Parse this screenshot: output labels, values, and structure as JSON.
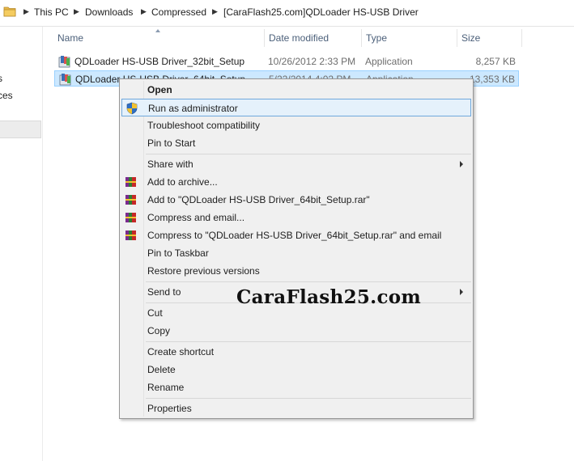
{
  "address_bar": {
    "breadcrumbs": [
      "This PC",
      "Downloads",
      "Compressed",
      "[CaraFlash25.com]QDLoader HS-USB Driver"
    ]
  },
  "nav_pane": {
    "partial_items": [
      "s",
      "ces"
    ]
  },
  "columns": {
    "name": "Name",
    "date_modified": "Date modified",
    "type": "Type",
    "size": "Size"
  },
  "files": [
    {
      "name": "QDLoader HS-USB Driver_32bit_Setup",
      "date": "10/26/2012 2:33 PM",
      "type": "Application",
      "size": "8,257 KB",
      "selected": false
    },
    {
      "name": "QDLoader HS-USB Driver_64bit_Setup",
      "date": "5/22/2014 4:02 PM",
      "type": "Application",
      "size": "13,353 KB",
      "selected": true
    }
  ],
  "context_menu": {
    "open": "Open",
    "run_as_admin": "Run as administrator",
    "troubleshoot": "Troubleshoot compatibility",
    "pin_to_start": "Pin to Start",
    "share_with": "Share with",
    "add_to_archive": "Add to archive...",
    "add_to_rar": "Add to \"QDLoader HS-USB Driver_64bit_Setup.rar\"",
    "compress_email": "Compress and email...",
    "compress_rar_email": "Compress to \"QDLoader HS-USB Driver_64bit_Setup.rar\" and email",
    "pin_to_taskbar": "Pin to Taskbar",
    "restore_versions": "Restore previous versions",
    "send_to": "Send to",
    "cut": "Cut",
    "copy": "Copy",
    "create_shortcut": "Create shortcut",
    "delete": "Delete",
    "rename": "Rename",
    "properties": "Properties"
  },
  "watermark": "CaraFlash25.com",
  "icons": {
    "address_folder": "folder-icon",
    "file": "installer-app-icon",
    "admin": "uac-shield-icon",
    "winrar": "winrar-books-icon"
  },
  "colors": {
    "selection_bg": "#cce8ff",
    "selection_border": "#99d1ff",
    "menu_bg": "#f0f0f0",
    "menu_hover_border": "#6fa8dc",
    "header_text": "#4c607a"
  }
}
